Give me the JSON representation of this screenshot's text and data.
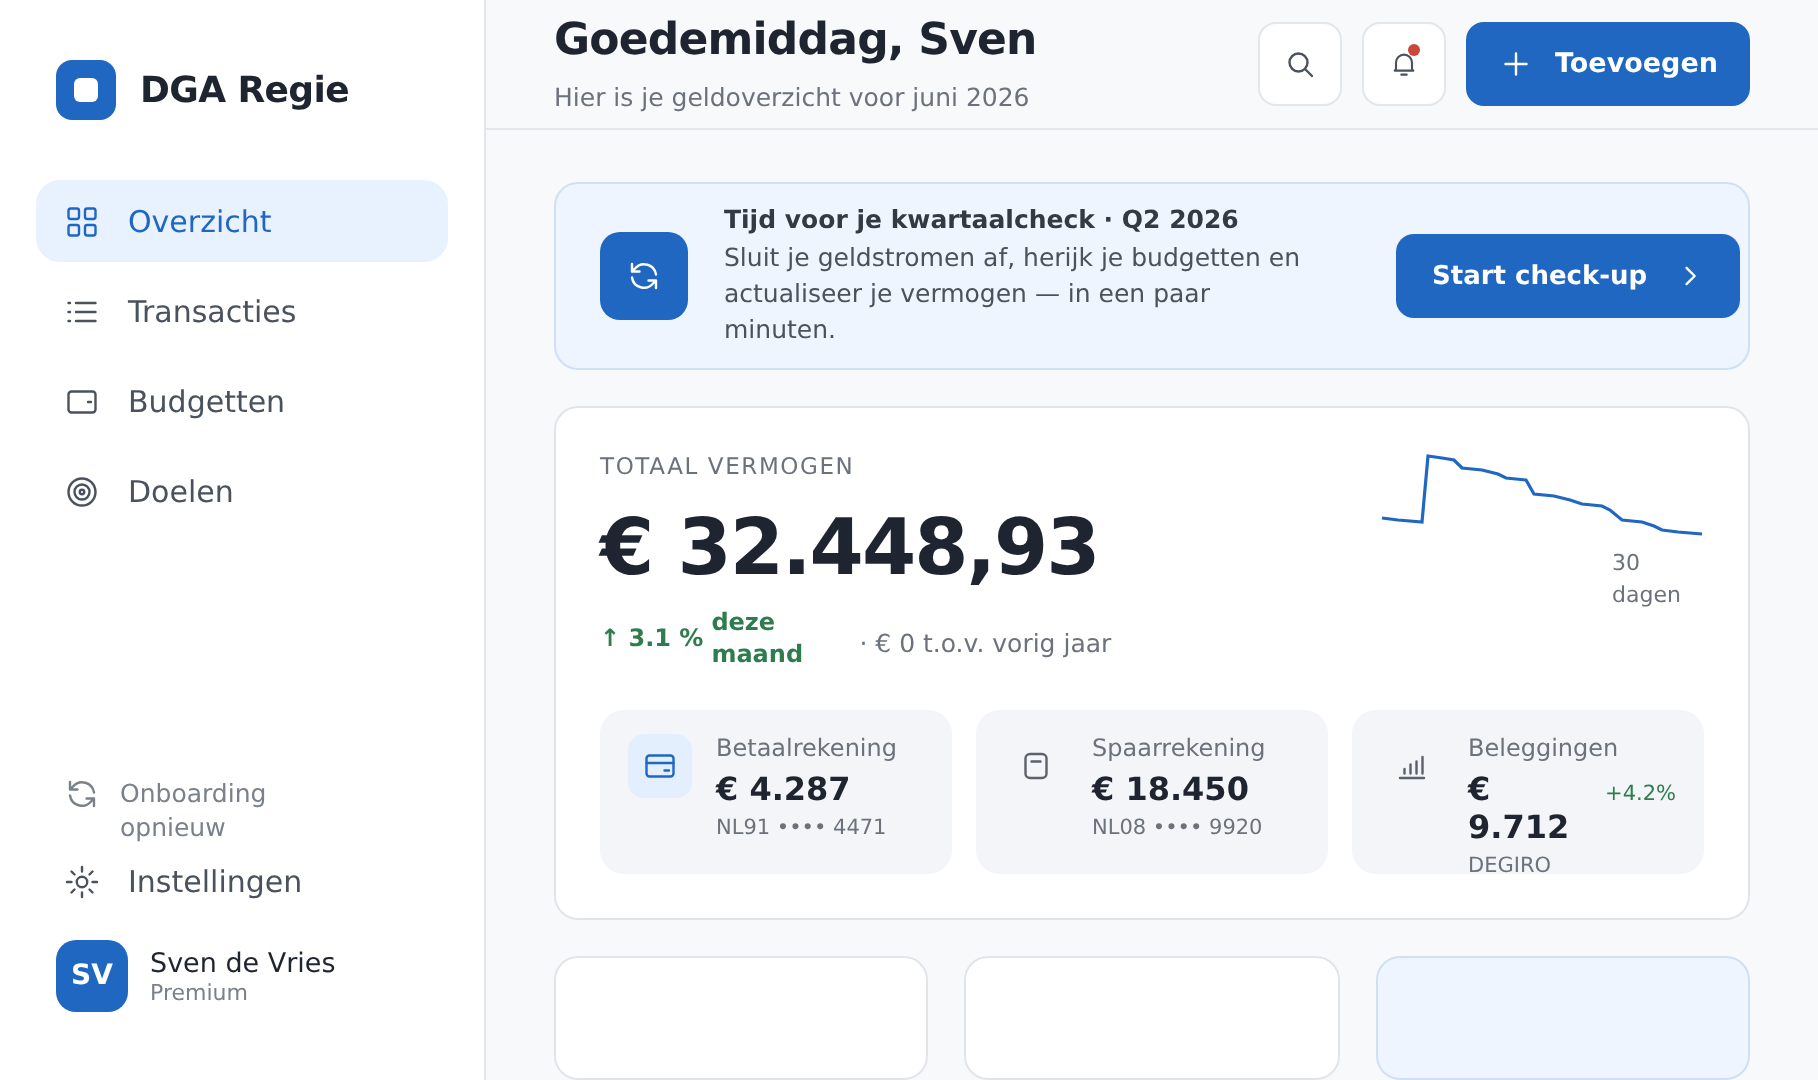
{
  "sidebar": {
    "brand": "DGA Regie",
    "items": [
      {
        "label": "Overzicht",
        "selected": true
      },
      {
        "label": "Transacties",
        "selected": false
      },
      {
        "label": "Budgetten",
        "selected": false
      },
      {
        "label": "Doelen",
        "selected": false
      }
    ],
    "footer_items": [
      {
        "label": "Onboarding opnieuw",
        "kind": "muted"
      },
      {
        "label": "Instellingen",
        "kind": "normal"
      }
    ],
    "user": {
      "initials": "SV",
      "name": "Sven de Vries",
      "plan": "Premium"
    }
  },
  "header": {
    "title": "Goedemiddag, Sven",
    "subtitle": "Hier is je geldoverzicht voor juni 2026",
    "notifications_unread": true,
    "add_button": "Toevoegen"
  },
  "banner": {
    "title": "Tijd voor je kwartaalcheck · Q2 2026",
    "text": "Sluit je geldstromen af, herijk je budgetten en actualiseer je vermogen — in een paar minuten.",
    "button": "Start check-up"
  },
  "net_worth": {
    "label": "TOTAAL VERMOGEN",
    "amount": "€ 32.448,93",
    "change": "↑ 3.1 %",
    "change_period": "deze maand",
    "yoy": "· € 0 t.o.v. vorig jaar",
    "sparkline_label": "30 dagen",
    "accounts": [
      {
        "name": "Betaalrekening",
        "amount": "€ 4.287",
        "detail": "NL91 •••• 4471",
        "highlighted": true
      },
      {
        "name": "Spaarrekening",
        "amount": "€ 18.450",
        "detail": "NL08 •••• 9920",
        "highlighted": false
      },
      {
        "name": "Beleggingen",
        "amount": "€ 9.712",
        "change": "+4.2%",
        "detail": "DEGIRO",
        "highlighted": false
      }
    ]
  },
  "bottom_cards": [
    {
      "tinted": false
    },
    {
      "tinted": false
    },
    {
      "tinted": true
    }
  ]
}
